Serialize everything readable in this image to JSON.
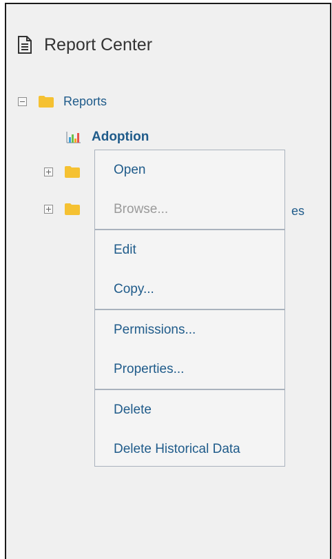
{
  "header": {
    "title": "Report Center",
    "icon": "document-icon"
  },
  "tree": {
    "root": {
      "label": "Reports",
      "expanded": true
    },
    "child": {
      "label": "Adoption",
      "icon": "bar-chart-icon"
    },
    "hidden_folder_text_fragment": "es"
  },
  "context_menu": {
    "open": "Open",
    "browse": "Browse...",
    "edit": "Edit",
    "copy": "Copy...",
    "permissions": "Permissions...",
    "properties": "Properties...",
    "delete": "Delete",
    "delete_historical": "Delete Historical Data"
  },
  "colors": {
    "link": "#1f5b8a",
    "folder": "#f5c132",
    "disabled": "#9a9a9a",
    "background": "#f0f0f0"
  }
}
